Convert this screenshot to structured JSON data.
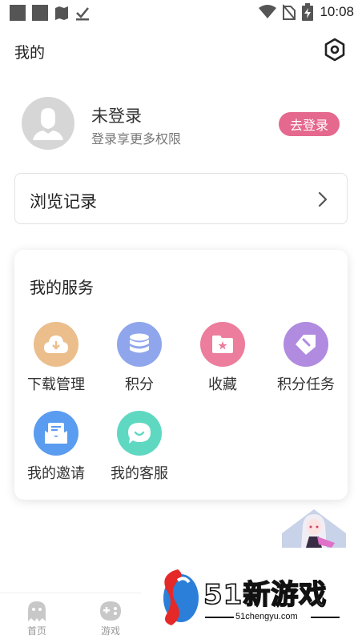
{
  "status_bar": {
    "time": "10:08"
  },
  "header": {
    "title": "我的"
  },
  "profile": {
    "name": "未登录",
    "subtitle": "登录享更多权限",
    "login_label": "去登录"
  },
  "history": {
    "label": "浏览记录"
  },
  "services": {
    "title": "我的服务",
    "items": [
      {
        "label": "下载管理",
        "icon": "download-icon",
        "color": "#ebbe8c"
      },
      {
        "label": "积分",
        "icon": "coins-icon",
        "color": "#8fa6ec"
      },
      {
        "label": "收藏",
        "icon": "favorite-folder-icon",
        "color": "#ec7d9c"
      },
      {
        "label": "积分任务",
        "icon": "task-tag-icon",
        "color": "#b08be0"
      },
      {
        "label": "我的邀请",
        "icon": "invite-envelope-icon",
        "color": "#5a9cf0"
      },
      {
        "label": "我的客服",
        "icon": "chat-bubble-icon",
        "color": "#5fd8c2"
      }
    ]
  },
  "ad": {
    "brand": "51新游戏",
    "domain": "51chengyu.com"
  },
  "tabbar": {
    "items": [
      {
        "label": "首页",
        "icon": "ghost-icon"
      },
      {
        "label": "游戏",
        "icon": "gamepad-icon"
      }
    ]
  },
  "colors": {
    "accent": "#e5688e"
  }
}
